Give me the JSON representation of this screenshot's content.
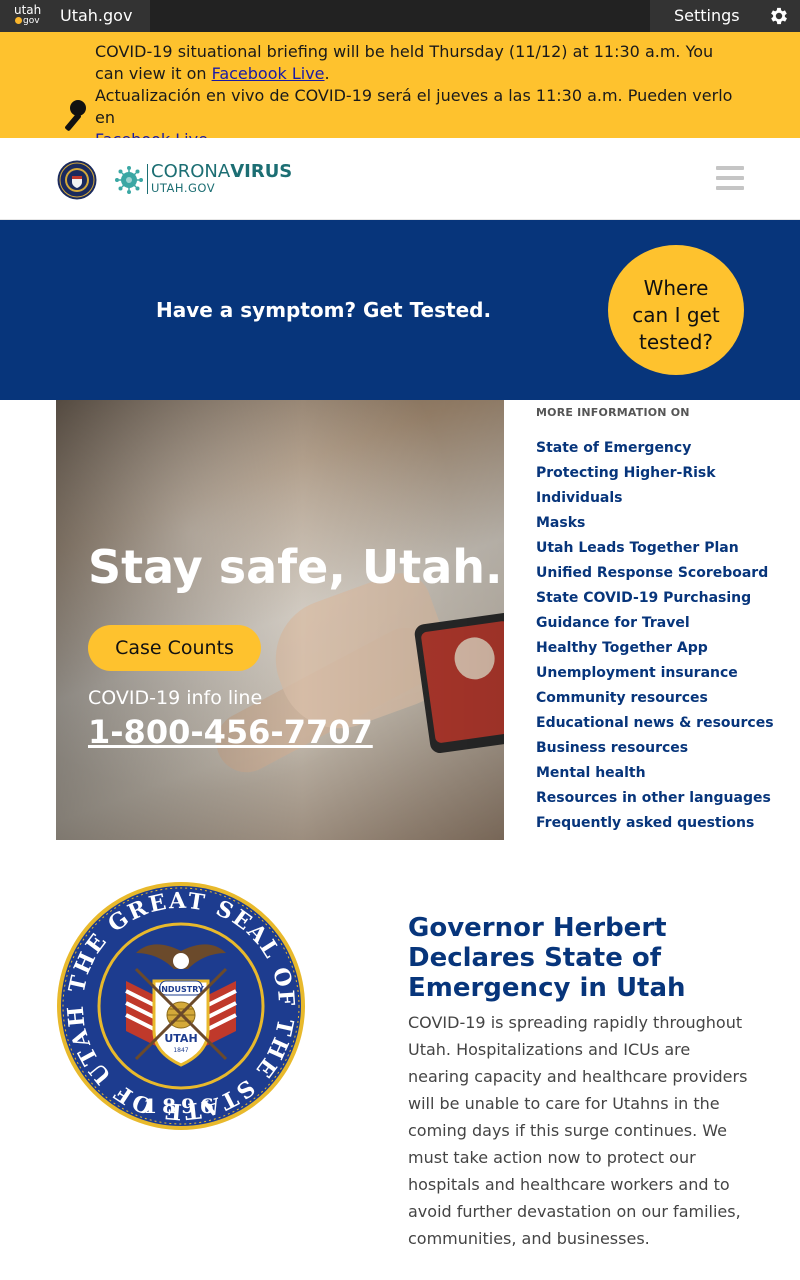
{
  "topbar": {
    "logo_top": "utah",
    "logo_bottom": "gov",
    "site_name": "Utah.gov",
    "settings_label": "Settings"
  },
  "alert": {
    "line1": "COVID-19 situational briefing will be held Thursday (11/12) at 11:30 a.m. You can view it on ",
    "link1": "Facebook Live",
    "line1_end": ".",
    "line2": "Actualización en vivo de COVID-19 será el jueves a las 11:30 a.m. Pueden verlo en ",
    "link2": "Facebook Live."
  },
  "header": {
    "brand_light": "CORONA",
    "brand_bold": "VIRUS",
    "brand_sub": "UTAH.GOV"
  },
  "cta": {
    "headline": "Have a symptom? Get Tested.",
    "circle_button": "Where can I get tested?"
  },
  "hero": {
    "title": "Stay safe, Utah.",
    "button": "Case Counts",
    "info_label": "COVID-19 info line",
    "phone": "1-800-456-7707"
  },
  "more_info": {
    "label": "MORE INFORMATION ON",
    "links": [
      "State of Emergency",
      "Protecting Higher-Risk Individuals",
      "Masks",
      "Utah Leads Together Plan",
      "Unified Response Scoreboard",
      "State COVID-19 Purchasing",
      "Guidance for Travel",
      "Healthy Together App",
      "Unemployment insurance",
      "Community resources",
      "Educational news & resources",
      "Business resources",
      "Mental health",
      "Resources in other languages",
      "Frequently asked questions"
    ]
  },
  "seal": {
    "ring_text": "THE GREAT SEAL OF THE STATE OF UTAH",
    "year": "1896",
    "banner": "INDUSTRY",
    "shield_text": "UTAH",
    "shield_year": "1847"
  },
  "news": {
    "title": "Governor Herbert Declares State of Emergency in Utah",
    "body": "COVID-19 is spreading rapidly throughout Utah. Hospitalizations and ICUs are nearing capacity and healthcare providers will be unable to care for Utahns in the coming days if this surge continues. We must take action now to protect our hospitals and healthcare workers and to avoid further devastation on our families, communities, and businesses."
  },
  "colors": {
    "navy": "#07357b",
    "gold": "#fec22e",
    "teal": "#1c6e73"
  }
}
